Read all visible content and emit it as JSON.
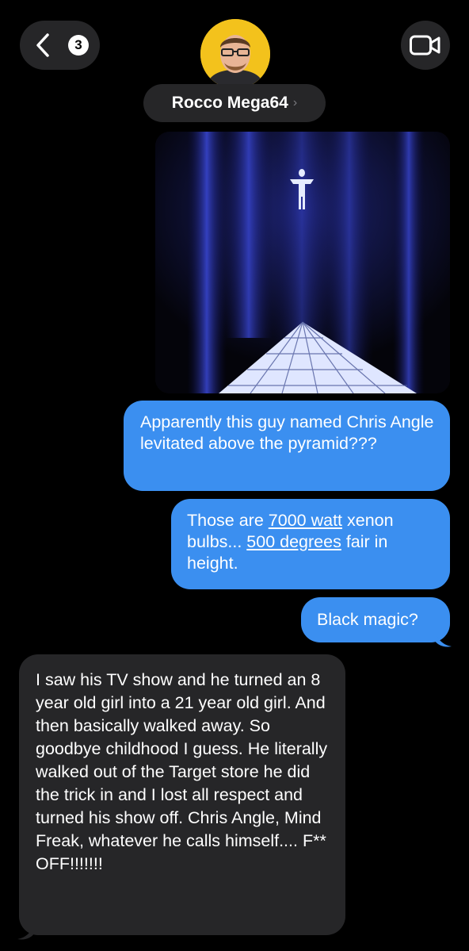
{
  "header": {
    "back_badge_count": "3",
    "contact_name": "Rocco Mega64",
    "contact_chevron": "›"
  },
  "icons": {
    "back": "chevron-left-icon",
    "video": "video-camera-icon"
  },
  "colors": {
    "outgoing_bubble": "#3b8ff0",
    "incoming_bubble": "#262628",
    "background": "#000000"
  },
  "messages": [
    {
      "direction": "outgoing",
      "type": "image"
    },
    {
      "direction": "outgoing",
      "text": "Apparently this guy named Chris Angle levitated above the pyramid???"
    },
    {
      "direction": "outgoing",
      "parts": [
        "Those are ",
        "7000 watt",
        " xenon bulbs... ",
        "500 degrees",
        " fair in height."
      ]
    },
    {
      "direction": "outgoing",
      "text": "Black magic?"
    },
    {
      "direction": "incoming",
      "text": "I saw his TV show and he turned an 8 year old girl into a 21 year old girl. And then basically walked away. So goodbye childhood I guess. He literally walked out of the Target store he did the trick in and I lost all respect and turned his show off. Chris Angle, Mind Freak, whatever he calls himself.... F** OFF!!!!!!!"
    }
  ]
}
